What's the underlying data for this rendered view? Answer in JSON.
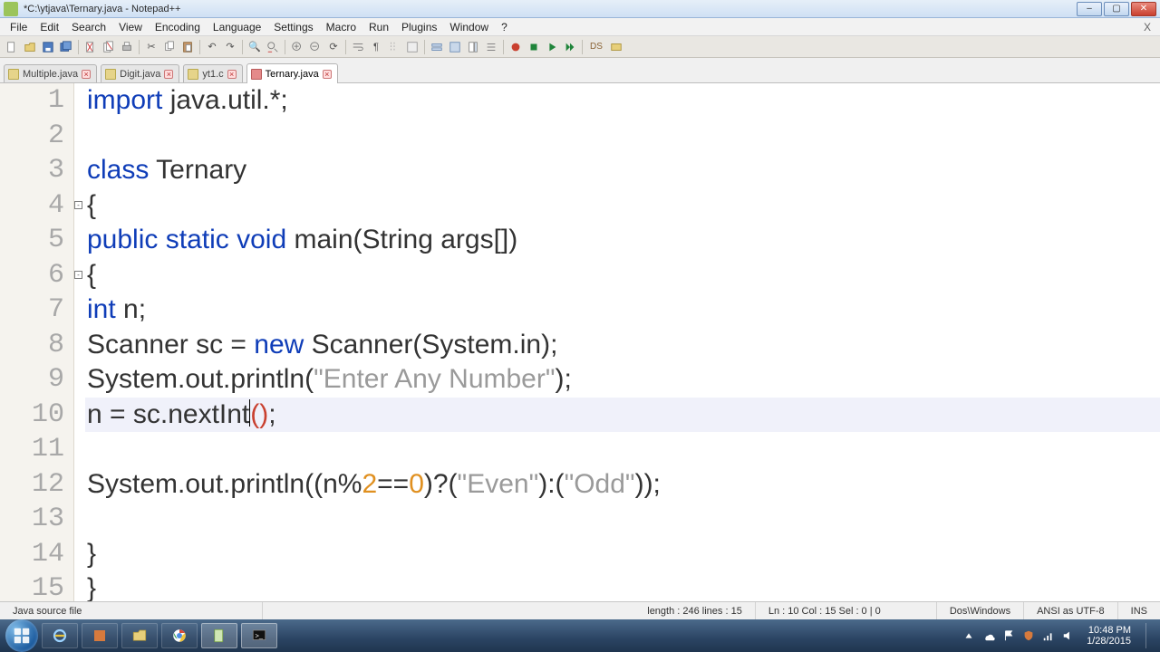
{
  "window": {
    "title": "*C:\\ytjava\\Ternary.java - Notepad++",
    "buttons": {
      "min": "–",
      "max": "▢",
      "close": "✕"
    }
  },
  "menu": {
    "items": [
      "File",
      "Edit",
      "Search",
      "View",
      "Encoding",
      "Language",
      "Settings",
      "Macro",
      "Run",
      "Plugins",
      "Window",
      "?"
    ],
    "xhint": "X"
  },
  "toolbar": {
    "icons": [
      "new",
      "open",
      "save",
      "save-all",
      "close",
      "close-all",
      "print",
      "cut",
      "copy",
      "paste",
      "undo",
      "redo",
      "find",
      "replace",
      "zoom-in",
      "zoom-out",
      "sync",
      "word-wrap",
      "show-chars",
      "indent-guide",
      "lang",
      "fold",
      "unfold",
      "doc-map",
      "func-list",
      "record",
      "stop",
      "play",
      "play-many",
      "ds",
      "settings"
    ]
  },
  "tabs": {
    "items": [
      {
        "label": "Multiple.java",
        "active": false
      },
      {
        "label": "Digit.java",
        "active": false
      },
      {
        "label": "yt1.c",
        "active": false
      },
      {
        "label": "Ternary.java",
        "active": true
      }
    ]
  },
  "code": {
    "lines": [
      {
        "n": 1,
        "tokens": [
          [
            "kw",
            "import"
          ],
          [
            "",
            " java.util.*;"
          ]
        ]
      },
      {
        "n": 2,
        "tokens": [
          [
            "",
            ""
          ]
        ]
      },
      {
        "n": 3,
        "tokens": [
          [
            "kw",
            "class"
          ],
          [
            "",
            " Ternary"
          ]
        ]
      },
      {
        "n": 4,
        "tokens": [
          [
            "",
            "{"
          ]
        ]
      },
      {
        "n": 5,
        "tokens": [
          [
            "kw",
            "public"
          ],
          [
            "",
            " "
          ],
          [
            "kw",
            "static"
          ],
          [
            "",
            " "
          ],
          [
            "kw",
            "void"
          ],
          [
            "",
            " main(String args[])"
          ]
        ]
      },
      {
        "n": 6,
        "tokens": [
          [
            "",
            "{"
          ]
        ]
      },
      {
        "n": 7,
        "tokens": [
          [
            "kw",
            "int"
          ],
          [
            "",
            " n;"
          ]
        ]
      },
      {
        "n": 8,
        "tokens": [
          [
            "",
            "Scanner sc = "
          ],
          [
            "kw",
            "new"
          ],
          [
            "",
            " Scanner(System.in);"
          ]
        ]
      },
      {
        "n": 9,
        "tokens": [
          [
            "",
            "System.out.println("
          ],
          [
            "str",
            "\"Enter Any Number\""
          ],
          [
            "",
            ");"
          ]
        ]
      },
      {
        "n": 10,
        "tokens": [
          [
            "",
            "n = sc.nextInt"
          ],
          [
            "cursor",
            ""
          ],
          [
            "paren-hl",
            "()"
          ],
          [
            "",
            ";"
          ]
        ],
        "current": true
      },
      {
        "n": 11,
        "tokens": [
          [
            "",
            ""
          ]
        ]
      },
      {
        "n": 12,
        "tokens": [
          [
            "",
            "System.out.println((n%"
          ],
          [
            "num",
            "2"
          ],
          [
            "",
            "=="
          ],
          [
            "num",
            "0"
          ],
          [
            "",
            ")?("
          ],
          [
            "str",
            "\"Even\""
          ],
          [
            "",
            "):("
          ],
          [
            "str",
            "\"Odd\""
          ],
          [
            "",
            "));"
          ]
        ]
      },
      {
        "n": 13,
        "tokens": [
          [
            "",
            ""
          ]
        ]
      },
      {
        "n": 14,
        "tokens": [
          [
            "",
            "}"
          ]
        ]
      },
      {
        "n": 15,
        "tokens": [
          [
            "",
            "}"
          ]
        ]
      }
    ],
    "fold_marks": [
      {
        "line": 4
      },
      {
        "line": 6
      }
    ]
  },
  "status": {
    "filetype": "Java source file",
    "length_label": "length : 246    lines : 15",
    "pos_label": "Ln : 10    Col : 15    Sel : 0 | 0",
    "eol": "Dos\\Windows",
    "encoding": "ANSI as UTF-8",
    "mode": "INS"
  },
  "taskbar": {
    "time": "10:48 PM",
    "date": "1/28/2015"
  }
}
